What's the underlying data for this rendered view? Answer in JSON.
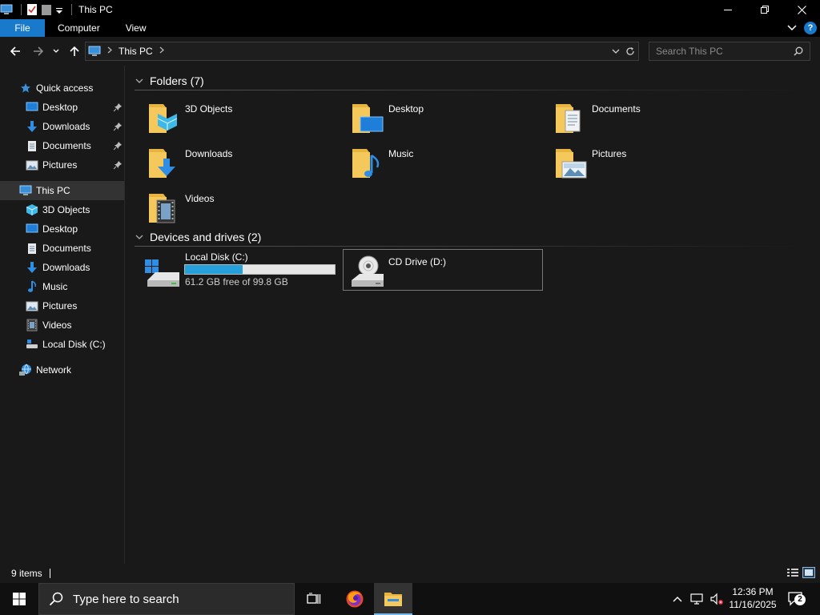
{
  "window": {
    "title": "This PC"
  },
  "ribbon": {
    "tabs": [
      "File",
      "Computer",
      "View"
    ],
    "help": "?"
  },
  "address": {
    "location": "This PC"
  },
  "search": {
    "placeholder": "Search This PC"
  },
  "sidebar": {
    "quick_access": {
      "label": "Quick access",
      "items": [
        {
          "label": "Desktop",
          "icon": "desktop-icon"
        },
        {
          "label": "Downloads",
          "icon": "downloads-icon"
        },
        {
          "label": "Documents",
          "icon": "documents-icon"
        },
        {
          "label": "Pictures",
          "icon": "pictures-icon"
        }
      ]
    },
    "this_pc": {
      "label": "This PC",
      "items": [
        {
          "label": "3D Objects",
          "icon": "3d-objects-icon"
        },
        {
          "label": "Desktop",
          "icon": "desktop-icon"
        },
        {
          "label": "Documents",
          "icon": "documents-icon"
        },
        {
          "label": "Downloads",
          "icon": "downloads-icon"
        },
        {
          "label": "Music",
          "icon": "music-icon"
        },
        {
          "label": "Pictures",
          "icon": "pictures-icon"
        },
        {
          "label": "Videos",
          "icon": "videos-icon"
        },
        {
          "label": "Local Disk (C:)",
          "icon": "local-disk-icon"
        }
      ]
    },
    "network": {
      "label": "Network"
    }
  },
  "content": {
    "folders_header": "Folders (7)",
    "folders": [
      {
        "label": "3D Objects"
      },
      {
        "label": "Desktop"
      },
      {
        "label": "Documents"
      },
      {
        "label": "Downloads"
      },
      {
        "label": "Music"
      },
      {
        "label": "Pictures"
      },
      {
        "label": "Videos"
      }
    ],
    "devices_header": "Devices and drives (2)",
    "drives": [
      {
        "label": "Local Disk (C:)",
        "free_text": "61.2 GB free of 99.8 GB",
        "used_fraction": 0.387
      },
      {
        "label": "CD Drive (D:)"
      }
    ]
  },
  "status": {
    "item_count": "9 items"
  },
  "taskbar": {
    "search_placeholder": "Type here to search",
    "time": "12:36 PM",
    "date": "11/16/2025",
    "notification_count": "2"
  },
  "colors": {
    "accent": "#1979ca",
    "folder": "#f5c85c",
    "progress": "#26a0da",
    "background": "#191919"
  }
}
